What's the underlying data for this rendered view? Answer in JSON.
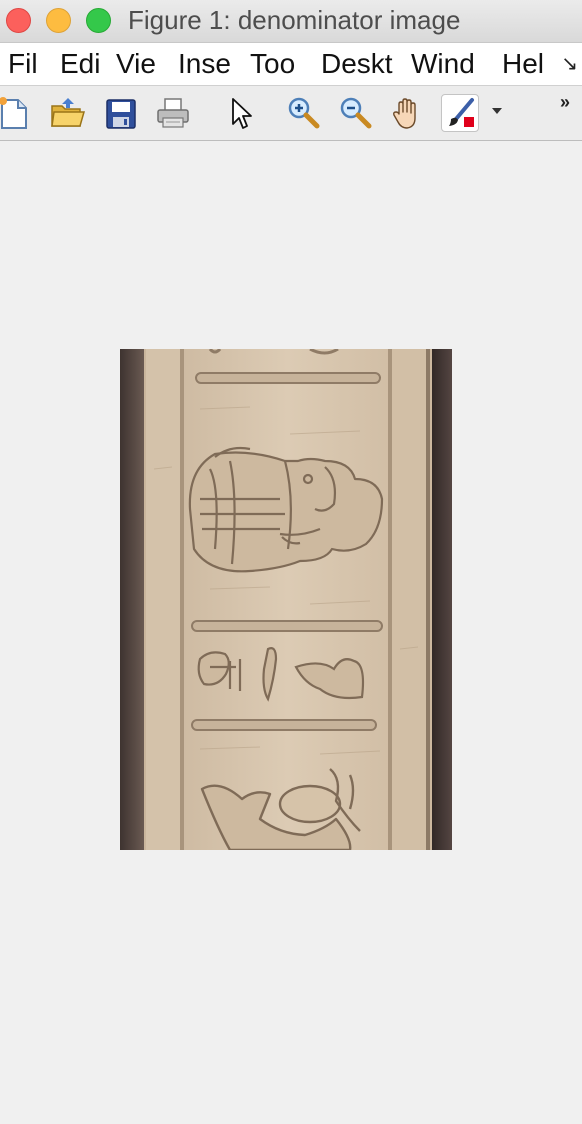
{
  "window": {
    "title": "Figure 1: denominator image"
  },
  "menu": {
    "items": [
      "Fil",
      "Edi",
      "Vie",
      "Inse",
      "Too",
      "Deskt",
      "Wind",
      "Hel"
    ],
    "overflow": "↘"
  },
  "toolbar": {
    "tools": [
      {
        "icon": "new-figure-icon"
      },
      {
        "icon": "open-file-icon"
      },
      {
        "icon": "save-icon"
      },
      {
        "icon": "print-icon"
      },
      {
        "icon": "select-arrow-icon"
      },
      {
        "icon": "zoom-in-icon"
      },
      {
        "icon": "zoom-out-icon"
      },
      {
        "icon": "pan-hand-icon"
      },
      {
        "icon": "brush-icon",
        "selected": true
      }
    ],
    "overflow": "»"
  },
  "figure": {
    "image": "hieroglyph-column-image",
    "colors": {
      "stone": "#d9c6ad",
      "shadow": "#4a3c38",
      "carving": "#8f7b66"
    }
  }
}
